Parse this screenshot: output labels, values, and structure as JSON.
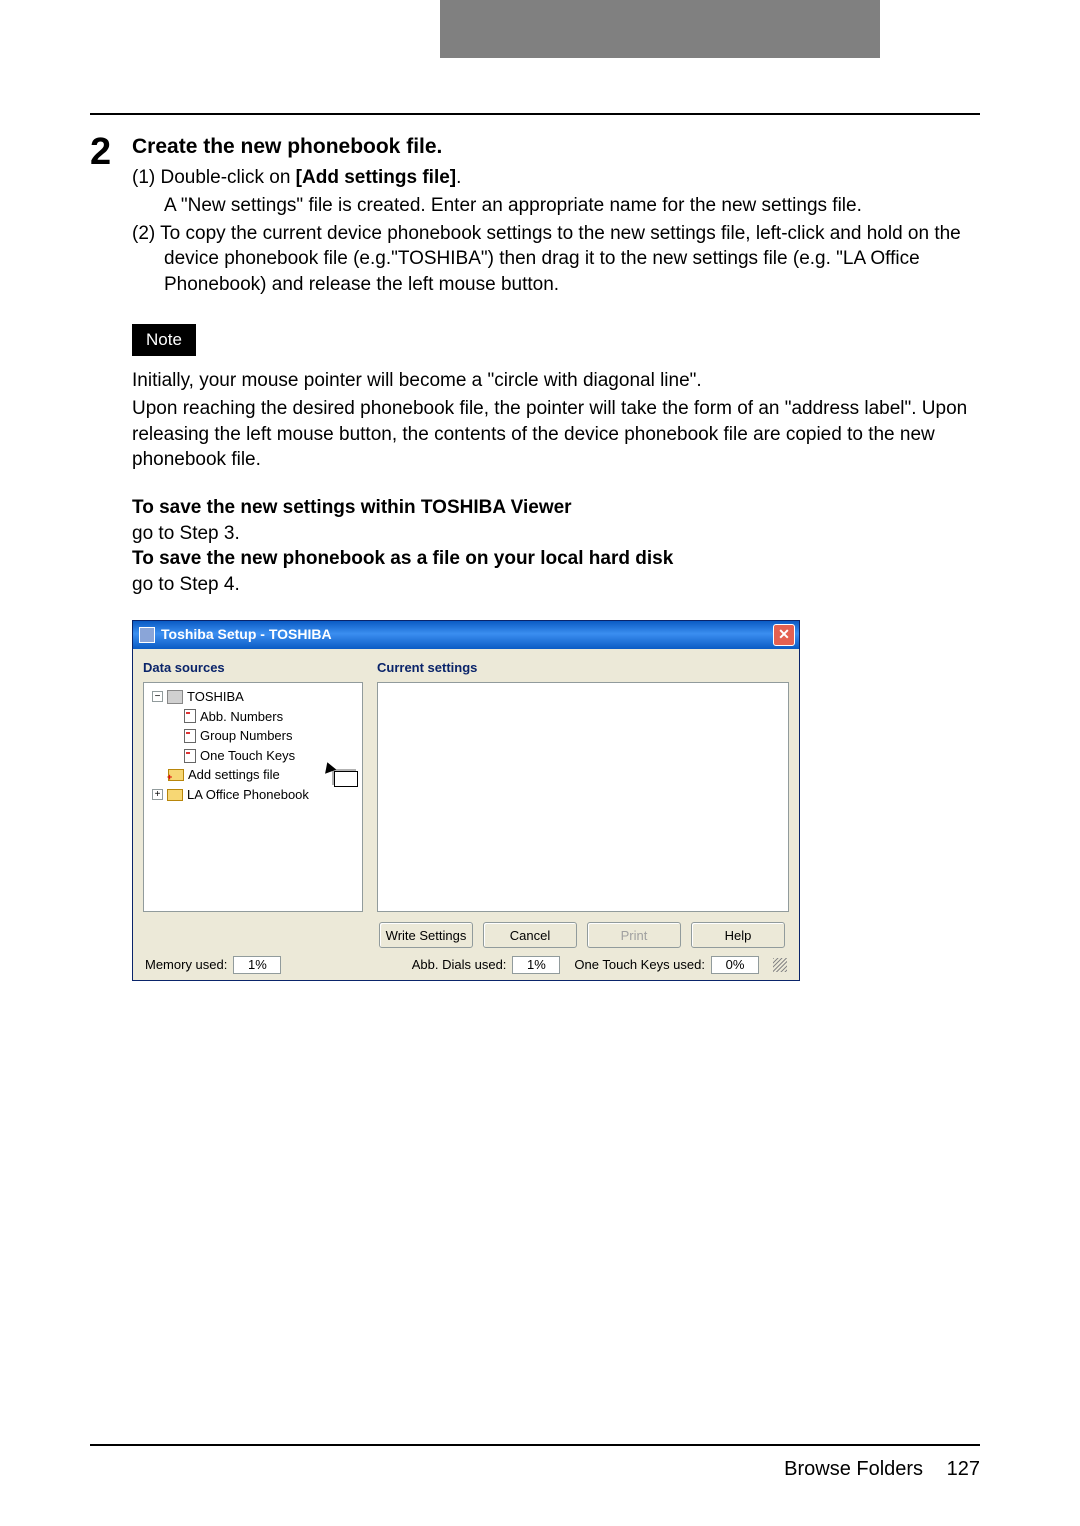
{
  "step": {
    "number": "2",
    "title": "Create the new phonebook file.",
    "sub1_prefix": "(1) Double-click on ",
    "sub1_bold": "[Add settings file]",
    "sub1_suffix": ".",
    "sub1_desc": "A \"New settings\" file is created. Enter an appropriate name for the new settings file.",
    "sub2": "(2) To copy the current device phonebook settings to the new settings file, left-click and hold on the device phonebook file (e.g.\"TOSHIBA\") then drag it to the new settings file (e.g. \"LA Office Phonebook) and release the left mouse button."
  },
  "note": {
    "label": "Note",
    "line1": "Initially, your mouse pointer will become a \"circle with diagonal line\".",
    "line2": "Upon reaching the desired phonebook file, the pointer will take the form of an \"address label\". Upon releasing the left mouse button, the contents of the device phonebook file are copied to the new phonebook file."
  },
  "save": {
    "line1_bold": "To save the new settings within TOSHIBA Viewer",
    "line1_rest": "go to Step 3.",
    "line2_bold": "To save the new phonebook as a file on your local hard disk",
    "line2_rest": "go to Step 4."
  },
  "dialog": {
    "title": "Toshiba Setup - TOSHIBA",
    "col_left": "Data sources",
    "col_right": "Current settings",
    "tree": {
      "root": "TOSHIBA",
      "item1": "Abb. Numbers",
      "item2": "Group Numbers",
      "item3": "One Touch Keys",
      "add": "Add settings file",
      "la": "LA Office Phonebook"
    },
    "buttons": {
      "write": "Write Settings",
      "cancel": "Cancel",
      "print": "Print",
      "help": "Help"
    },
    "status": {
      "mem_label": "Memory used:",
      "mem_val": "1%",
      "dials_label": "Abb. Dials used:",
      "dials_val": "1%",
      "keys_label": "One Touch Keys used:",
      "keys_val": "0%"
    }
  },
  "footer": {
    "section": "Browse Folders",
    "page": "127"
  }
}
